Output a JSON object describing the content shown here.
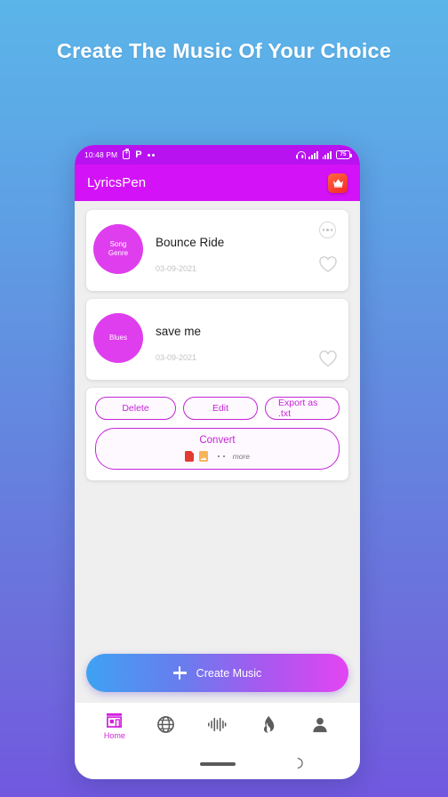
{
  "headline": "Create The Music Of Your Choice",
  "statusbar": {
    "time": "10:48 PM",
    "battery_percent": "75",
    "left_icons": [
      "battery-saver-icon",
      "p-app-icon",
      "notification-dots-icon"
    ],
    "right_icons": [
      "headphone-icon",
      "signal-bars-icon",
      "signal-bars-icon",
      "battery-icon"
    ]
  },
  "appbar": {
    "title": "LyricsPen",
    "premium_icon": "crown-icon",
    "bg_color": "#D412F7"
  },
  "songs": [
    {
      "genre_line1": "Song",
      "genre_line2": "Genre",
      "title": "Bounce Ride",
      "date": "03-09-2021",
      "has_more_menu": true,
      "favorite_icon": "heart-outline-icon",
      "circle_color": "#DF3EEE"
    },
    {
      "genre_line1": "Blues",
      "genre_line2": "",
      "title": "save me",
      "date": "03-09-2021",
      "has_more_menu": false,
      "favorite_icon": "heart-outline-icon",
      "circle_color": "#DF3EEE"
    }
  ],
  "actions": {
    "delete_label": "Delete",
    "edit_label": "Edit",
    "export_label": "Export as .txt",
    "convert_label": "Convert",
    "more_label": "more",
    "format_icons": [
      "pdf-file-icon",
      "image-file-icon"
    ],
    "accent_color": "#C425D6"
  },
  "cta": {
    "label": "Create Music",
    "icon": "plus-icon"
  },
  "bottomnav": {
    "items": [
      {
        "icon": "store-home-icon",
        "label": "Home",
        "active": true
      },
      {
        "icon": "globe-icon",
        "label": "",
        "active": false
      },
      {
        "icon": "audio-waveform-icon",
        "label": "",
        "active": false
      },
      {
        "icon": "flame-icon",
        "label": "",
        "active": false
      },
      {
        "icon": "person-icon",
        "label": "",
        "active": false
      }
    ],
    "active_color": "#D41FE0",
    "inactive_color": "#5c5c5c"
  },
  "sysnav": {
    "home_indicator": "home-pill-indicator",
    "back_icon": "back-arc-icon"
  }
}
